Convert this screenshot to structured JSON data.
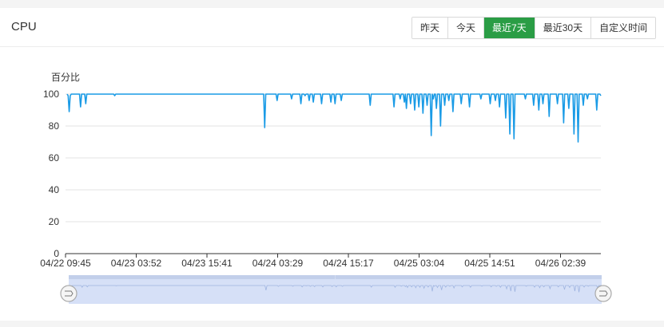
{
  "panel": {
    "title": "CPU",
    "time_ranges": [
      "昨天",
      "今天",
      "最近7天",
      "最近30天",
      "自定义时间"
    ],
    "active_range": "最近7天",
    "accent_color": "#2a9d45"
  },
  "chart_data": {
    "type": "line",
    "ylabel": "百分比",
    "ylim": [
      0,
      100
    ],
    "yticks": [
      0,
      20,
      40,
      60,
      80,
      100
    ],
    "xticks": [
      "04/22 09:45",
      "04/23 03:52",
      "04/23 15:41",
      "04/24 03:29",
      "04/24 15:17",
      "04/25 03:04",
      "04/25 14:51",
      "04/26 02:39"
    ],
    "grid": true,
    "line_color": "#1a9be6",
    "series": [
      {
        "values": [
          100,
          99,
          89,
          99,
          100,
          100,
          100,
          100,
          100,
          100,
          100,
          100,
          100,
          92,
          100,
          100,
          100,
          100,
          94,
          100,
          100,
          100,
          100,
          100,
          100,
          100,
          100,
          100,
          100,
          100,
          100,
          100,
          100,
          100,
          100,
          100,
          100,
          100,
          100,
          100,
          100,
          100,
          100,
          100,
          100,
          100,
          99,
          100,
          100,
          100,
          100,
          100,
          100,
          100,
          100,
          100,
          100,
          100,
          100,
          100,
          100,
          100,
          100,
          100,
          100,
          100,
          100,
          100,
          100,
          100,
          100,
          100,
          100,
          100,
          100,
          100,
          100,
          100,
          100,
          100,
          100,
          100,
          100,
          100,
          100,
          100,
          100,
          100,
          100,
          100,
          100,
          100,
          100,
          100,
          100,
          100,
          100,
          100,
          100,
          100,
          100,
          100,
          100,
          100,
          100,
          100,
          100,
          100,
          100,
          100,
          100,
          100,
          100,
          100,
          100,
          100,
          100,
          100,
          100,
          100,
          100,
          100,
          100,
          100,
          100,
          100,
          100,
          100,
          100,
          100,
          100,
          100,
          100,
          100,
          100,
          100,
          100,
          100,
          100,
          100,
          100,
          100,
          100,
          100,
          100,
          100,
          100,
          100,
          100,
          100,
          100,
          100,
          100,
          100,
          100,
          100,
          100,
          100,
          100,
          100,
          100,
          100,
          100,
          100,
          100,
          100,
          100,
          100,
          100,
          100,
          100,
          100,
          100,
          100,
          100,
          100,
          100,
          100,
          100,
          100,
          100,
          100,
          100,
          100,
          100,
          100,
          100,
          100,
          100,
          100,
          100,
          79,
          100,
          100,
          100,
          100,
          100,
          100,
          100,
          100,
          100,
          100,
          100,
          96,
          100,
          100,
          100,
          100,
          100,
          100,
          100,
          100,
          100,
          100,
          100,
          100,
          100,
          97,
          100,
          100,
          100,
          100,
          100,
          100,
          100,
          100,
          94,
          100,
          100,
          100,
          99,
          100,
          100,
          100,
          96,
          100,
          100,
          100,
          95,
          100,
          100,
          100,
          100,
          100,
          100,
          100,
          94,
          100,
          100,
          100,
          100,
          100,
          100,
          100,
          100,
          95,
          100,
          100,
          100,
          94,
          100,
          100,
          100,
          100,
          100,
          96,
          100,
          100,
          100,
          100,
          100,
          100,
          100,
          100,
          100,
          100,
          100,
          100,
          100,
          100,
          100,
          100,
          100,
          100,
          100,
          100,
          100,
          100,
          100,
          100,
          100,
          100,
          100,
          93,
          100,
          100,
          100,
          100,
          100,
          100,
          100,
          100,
          100,
          100,
          100,
          100,
          100,
          100,
          100,
          100,
          100,
          100,
          100,
          100,
          100,
          100,
          92,
          100,
          100,
          100,
          100,
          100,
          97,
          100,
          100,
          100,
          95,
          100,
          91,
          100,
          100,
          100,
          94,
          100,
          100,
          100,
          90,
          100,
          100,
          100,
          92,
          100,
          100,
          100,
          88,
          100,
          100,
          100,
          93,
          100,
          100,
          100,
          74,
          100,
          97,
          100,
          100,
          91,
          100,
          100,
          100,
          80,
          100,
          100,
          100,
          93,
          100,
          100,
          100,
          96,
          100,
          100,
          100,
          89,
          100,
          100,
          100,
          100,
          100,
          100,
          100,
          94,
          100,
          100,
          100,
          100,
          100,
          100,
          100,
          92,
          100,
          100,
          100,
          100,
          100,
          100,
          100,
          100,
          100,
          100,
          97,
          100,
          100,
          100,
          100,
          100,
          100,
          100,
          100,
          94,
          100,
          100,
          100,
          100,
          96,
          100,
          100,
          100,
          92,
          100,
          100,
          100,
          100,
          100,
          85,
          100,
          100,
          100,
          75,
          100,
          100,
          100,
          72,
          100,
          100,
          100,
          100,
          100,
          100,
          100,
          100,
          100,
          100,
          97,
          100,
          100,
          100,
          100,
          100,
          100,
          100,
          93,
          100,
          100,
          100,
          100,
          90,
          100,
          100,
          100,
          94,
          100,
          100,
          100,
          100,
          100,
          86,
          100,
          100,
          100,
          100,
          100,
          100,
          100,
          94,
          100,
          100,
          100,
          100,
          100,
          82,
          100,
          100,
          100,
          100,
          91,
          100,
          100,
          100,
          100,
          75,
          100,
          100,
          100,
          70,
          100,
          100,
          100,
          100,
          93,
          100,
          100,
          100,
          97,
          100,
          100,
          100,
          100,
          100,
          100,
          100,
          100,
          90,
          100,
          100,
          100,
          99
        ]
      }
    ]
  },
  "zoom": {
    "start_pct": 0,
    "end_pct": 100
  }
}
